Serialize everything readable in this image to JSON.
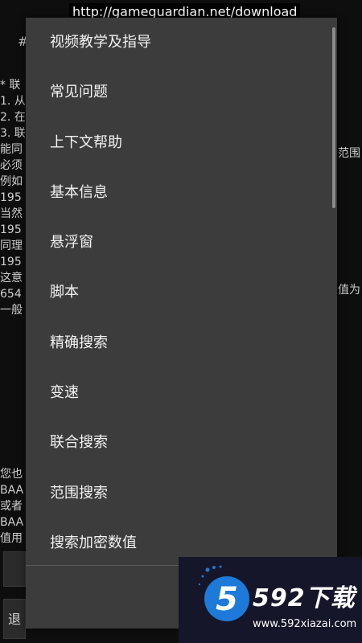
{
  "url_bar": {
    "text": "http://gameguardian.net/download"
  },
  "background": {
    "hash": "#",
    "left_lines": [
      "* 联",
      "1. 从",
      "2. 在",
      "3. 联",
      "能同",
      "必须",
      "例如",
      "195",
      "当然",
      "195",
      "同理",
      "195",
      "这意",
      "654",
      "一般"
    ],
    "right_lines": [
      {
        "text": "范围"
      },
      {
        "text": "值为"
      }
    ],
    "bottom_lines": [
      "您也",
      "BAA",
      "或者",
      "BAA",
      "值用"
    ],
    "buttons": {
      "exit_label": "退"
    }
  },
  "menu": {
    "items": [
      {
        "label": "视频教学及指导"
      },
      {
        "label": "常见问题"
      },
      {
        "label": "上下文帮助"
      },
      {
        "label": "基本信息"
      },
      {
        "label": "悬浮窗"
      },
      {
        "label": "脚本"
      },
      {
        "label": "精确搜索"
      },
      {
        "label": "变速"
      },
      {
        "label": "联合搜索"
      },
      {
        "label": "范围搜索"
      },
      {
        "label": "搜索加密数值"
      }
    ]
  },
  "watermark": {
    "title": "592下载",
    "url": "www.592xiazai.com",
    "logo_digit": "5",
    "accent": "#1e7ad8"
  }
}
